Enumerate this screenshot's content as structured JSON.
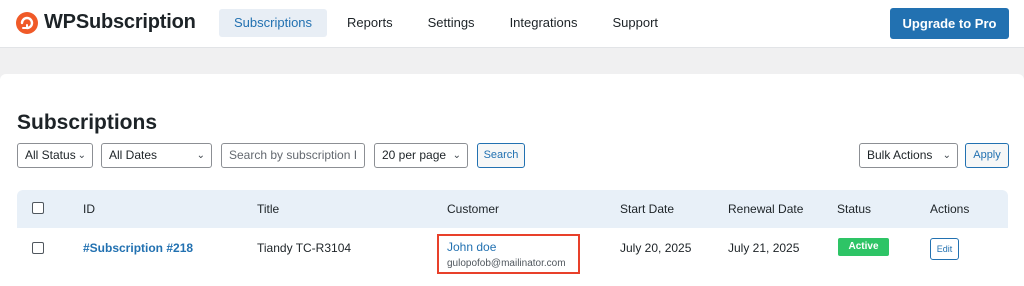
{
  "header": {
    "logo_text": "WPSubscription",
    "nav": [
      {
        "label": "Subscriptions",
        "active": true
      },
      {
        "label": "Reports",
        "active": false
      },
      {
        "label": "Settings",
        "active": false
      },
      {
        "label": "Integrations",
        "active": false
      },
      {
        "label": "Support",
        "active": false
      }
    ],
    "upgrade_label": "Upgrade to Pro"
  },
  "page": {
    "title": "Subscriptions"
  },
  "filters": {
    "status_selected": "All Status",
    "dates_selected": "All Dates",
    "search_placeholder": "Search by subscription I",
    "per_page_selected": "20 per page",
    "search_button": "Search",
    "bulk_actions_selected": "Bulk Actions",
    "apply_button": "Apply"
  },
  "table": {
    "columns": [
      "ID",
      "Title",
      "Customer",
      "Start Date",
      "Renewal Date",
      "Status",
      "Actions"
    ],
    "rows": [
      {
        "id": "#Subscription #218",
        "title": "Tiandy TC-R3104",
        "customer_name": "John doe",
        "customer_email": "gulopofob@mailinator.com",
        "start_date": "July 20, 2025",
        "renewal_date": "July 21, 2025",
        "status": "Active",
        "action": "Edit"
      }
    ]
  },
  "colors": {
    "accent": "#2271b1",
    "brand": "#f05a28",
    "active_badge": "#2ec466",
    "highlight_box": "#e8402a"
  },
  "icons": [
    "logo-icon",
    "chevron-down-icon"
  ]
}
